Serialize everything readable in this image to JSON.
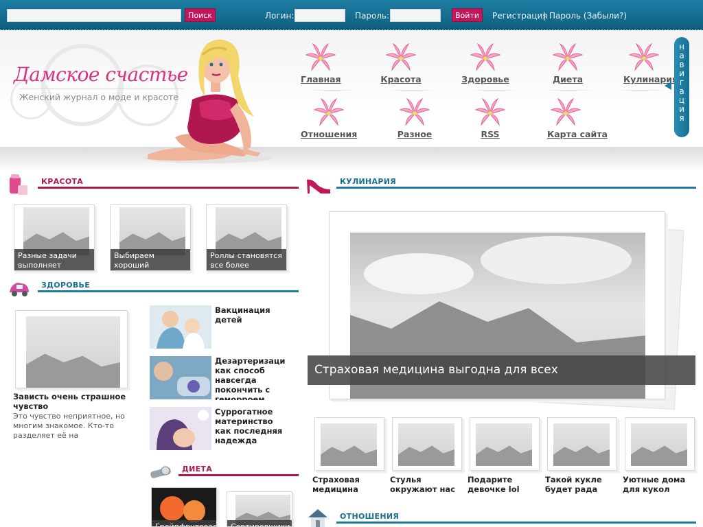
{
  "topbar": {
    "search_button": "Поиск",
    "login_label": "Логин:",
    "password_label": "Пароль:",
    "login_button": "Войти",
    "register_link": "Регистрация",
    "separator": "|",
    "forgot_link": "Пароль (Забыли?)",
    "search_value": "",
    "login_value": "",
    "password_value": ""
  },
  "header": {
    "title": "Дамское счастье",
    "subtitle": "Женский журнал о моде и красоте"
  },
  "nav": {
    "items": [
      "Главная",
      "Красота",
      "Здоровье",
      "Диета",
      "Кулинария",
      "Отношения",
      "Разное",
      "RSS",
      "Карта сайта"
    ],
    "tab_letters": [
      "н",
      "а",
      "в",
      "и",
      "г",
      "а",
      "ц",
      "и",
      "я"
    ]
  },
  "colors": {
    "accent_pink": "#c2185b",
    "accent_blue": "#1d7ea3",
    "title_pink": "#d63384"
  },
  "sections": {
    "beauty": {
      "heading": "КРАСОТА",
      "items": [
        "Разные задачи выполняет",
        "Выбираем хороший твердотопливный",
        "Роллы становятся все более"
      ]
    },
    "health": {
      "heading": "ЗДОРОВЬЕ",
      "main_title": "Зависть очень страшное чувство",
      "main_excerpt": "Это чувство неприятное, но многим знакомое. Кто-то разделяет её на",
      "side_items": [
        "Вакцинация детей",
        "Дезартеризаци как способ навсегда покончить с геморроем",
        "Суррогатное материнство как последняя надежда"
      ]
    },
    "diet": {
      "heading": "ДИЕТА",
      "items": [
        "Грейпфрутовая",
        "Сортировщики"
      ]
    },
    "cooking": {
      "heading": "КУЛИНАРИЯ",
      "featured_caption": "Страховая медицина выгодна для всех",
      "items": [
        "Страховая медицина",
        "Стулья окружают нас",
        "Подарите девочке lol",
        "Такой кукле будет рада",
        "Уютные дома для кукол"
      ]
    },
    "relations": {
      "heading": "ОТНОШЕНИЯ"
    }
  }
}
